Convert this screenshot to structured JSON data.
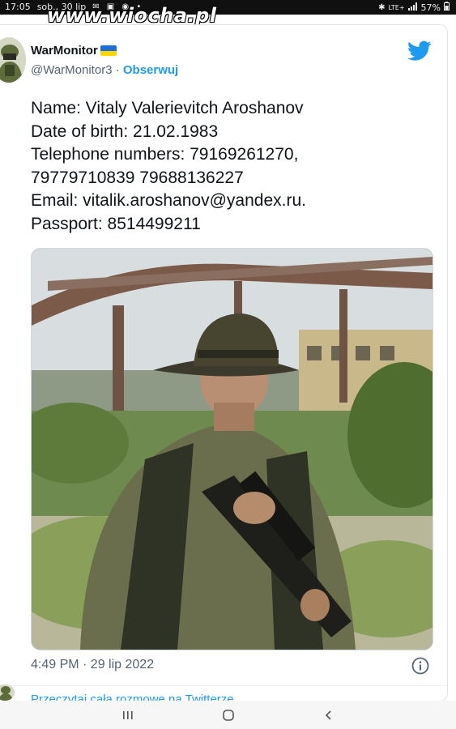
{
  "status_bar": {
    "time": "17:05",
    "date": "sob., 30 lip",
    "battery": "57%",
    "network": "LTE+"
  },
  "watermark": "www.wiocha.pl",
  "tweet": {
    "author_name": "WarMonitor",
    "handle": "@WarMonitor3",
    "separator": " · ",
    "follow_label": "Obserwuj",
    "text": "Name: Vitaly Valerievitch Aroshanov\nDate of birth: 21.02.1983\nTelephone numbers: 79169261270,\n79779710839 79688136227\nEmail: vitalik.aroshanov@yandex.ru.\nPassport: 8514499211",
    "timestamp": "4:49 PM · 29 lip 2022",
    "read_more": "Przeczytaj całą rozmowę na Twitterze"
  },
  "colors": {
    "link": "#1d9bf0",
    "secondary_text": "#536471",
    "twitter_blue": "#1d9bf0"
  },
  "icons": {
    "brand": "twitter-bird-icon",
    "info": "info-icon",
    "nav": [
      "recents-icon",
      "home-icon",
      "back-icon"
    ]
  }
}
